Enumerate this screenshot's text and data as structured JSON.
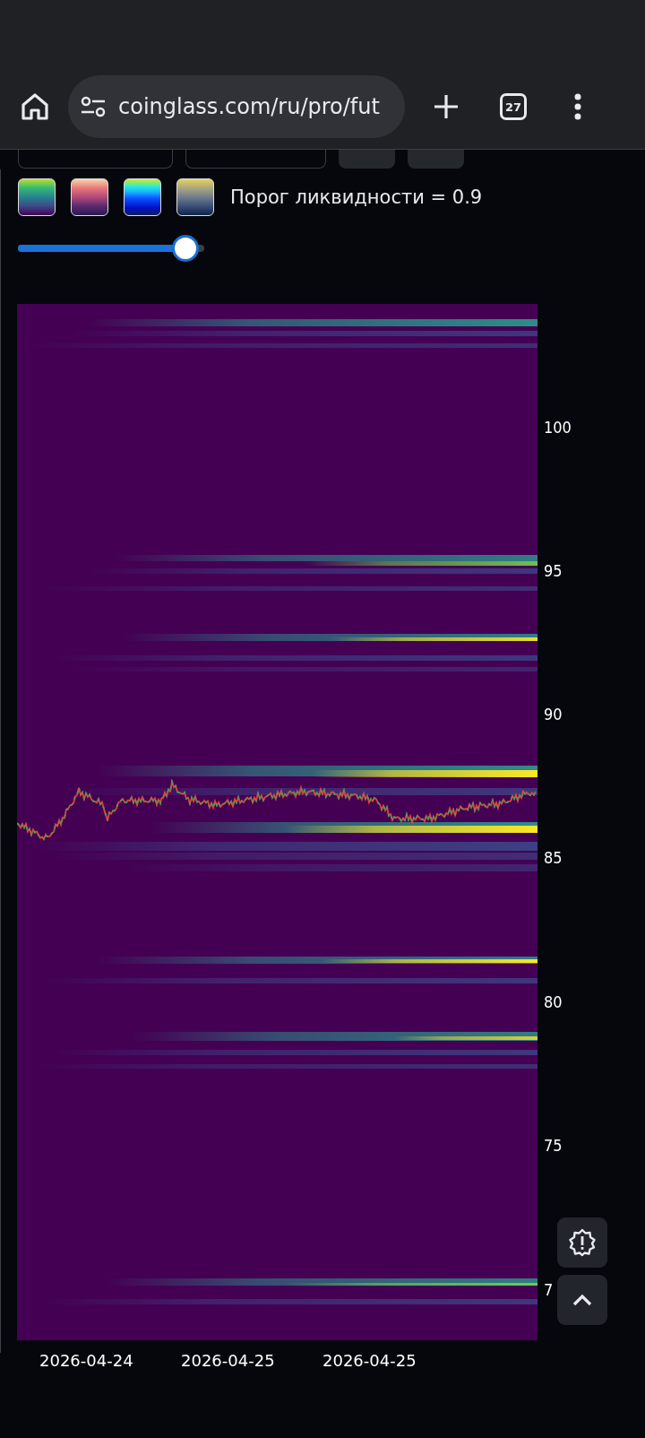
{
  "browser": {
    "url": "coinglass.com/ru/pro/fut",
    "tab_count": "27"
  },
  "colormaps": [
    {
      "kind": "viridis"
    },
    {
      "kind": "sunset"
    },
    {
      "kind": "jet"
    },
    {
      "kind": "cividis"
    }
  ],
  "threshold_label": "Порог ликвидности = 0.9",
  "threshold_slider": {
    "level": 0.9
  },
  "chart": {
    "y_labels": [
      "100",
      "95",
      "90",
      "85",
      "80",
      "75",
      "7"
    ],
    "x_labels": [
      "2026-04-24",
      "2026-04-25",
      "2026-04-25"
    ]
  }
}
